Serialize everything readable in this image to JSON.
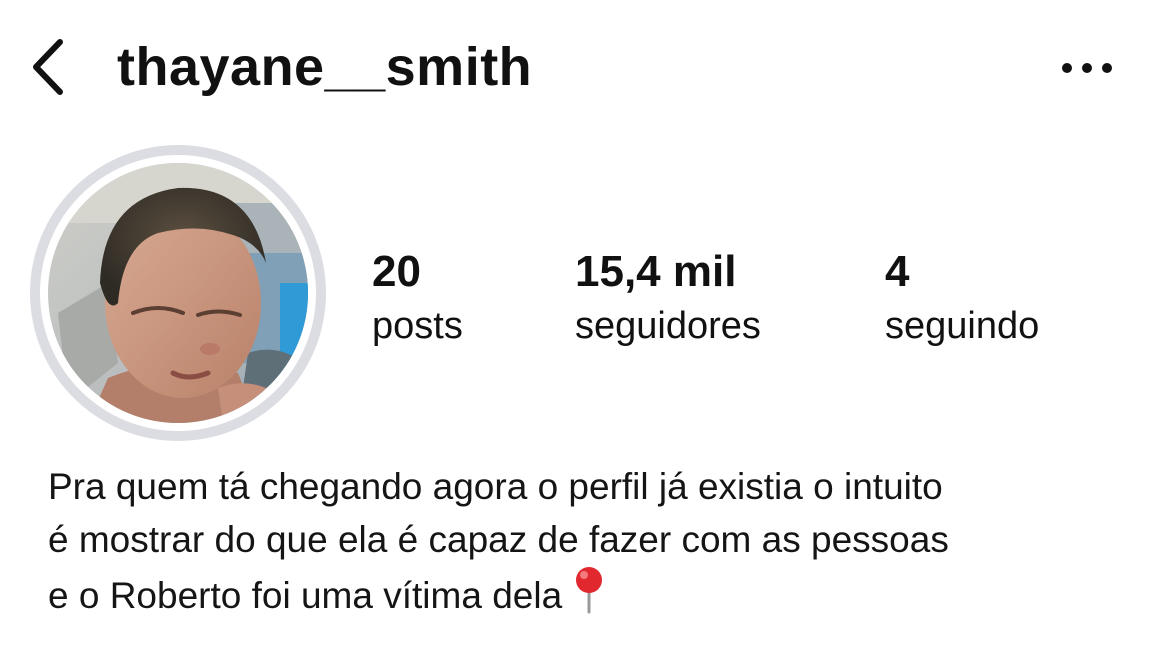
{
  "header": {
    "username": "thayane__smith",
    "back_icon": "chevron-left-icon",
    "more_icon": "more-horizontal-icon"
  },
  "profile": {
    "avatar_ring_color": "#dcdde2"
  },
  "stats": [
    {
      "value": "20",
      "label": "posts"
    },
    {
      "value": "15,4 mil",
      "label": "seguidores"
    },
    {
      "value": "4",
      "label": "seguindo"
    }
  ],
  "bio": {
    "lines": [
      "Pra quem tá chegando agora o perfil já existia o intuito",
      "é mostrar do que ela é capaz de fazer com as pessoas",
      "e o Roberto foi uma vítima dela"
    ],
    "emoji_icon": "round-pushpin-icon"
  }
}
